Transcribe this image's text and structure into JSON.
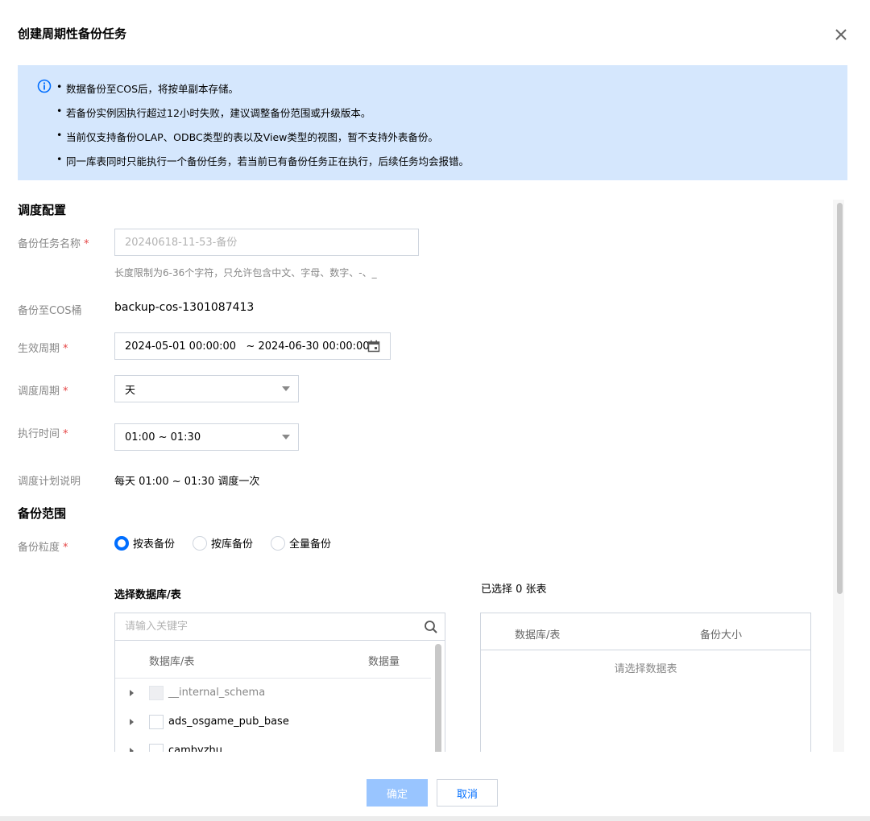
{
  "dialog": {
    "title": "创建周期性备份任务"
  },
  "notice": {
    "items": [
      "数据备份至COS后，将按单副本存储。",
      "若备份实例因执行超过12小时失败，建议调整备份范围或升级版本。",
      "当前仅支持备份OLAP、ODBC类型的表以及View类型的视图，暂不支持外表备份。",
      "同一库表同时只能执行一个备份任务，若当前已有备份任务正在执行，后续任务均会报错。"
    ]
  },
  "schedule": {
    "section_title": "调度配置",
    "task_name": {
      "label": "备份任务名称",
      "placeholder": "20240618-11-53-备份",
      "value": "",
      "hint": "长度限制为6-36个字符，只允许包含中文、字母、数字、-、_"
    },
    "cos_bucket": {
      "label": "备份至COS桶",
      "value": "backup-cos-1301087413"
    },
    "effective_period": {
      "label": "生效周期",
      "value": "2024-05-01 00:00:00   ~ 2024-06-30 00:00:00"
    },
    "schedule_cycle": {
      "label": "调度周期",
      "value": "天"
    },
    "exec_time": {
      "label": "执行时间",
      "value": "01:00 ~ 01:30"
    },
    "plan_desc": {
      "label": "调度计划说明",
      "value": "每天 01:00 ~ 01:30 调度一次"
    }
  },
  "scope": {
    "section_title": "备份范围",
    "granularity": {
      "label": "备份粒度",
      "options": [
        "按表备份",
        "按库备份",
        "全量备份"
      ],
      "selected": "按表备份"
    },
    "select_title": "选择数据库/表",
    "search_placeholder": "请输入关键字",
    "tree_columns": [
      "数据库/表",
      "数据量"
    ],
    "tree_rows": [
      {
        "name": "__internal_schema",
        "disabled": true
      },
      {
        "name": "ads_osgame_pub_base",
        "disabled": false
      },
      {
        "name": "cambyzhu",
        "disabled": false
      }
    ],
    "selected_title": "已选择 0 张表",
    "selected_columns": [
      "数据库/表",
      "备份大小"
    ],
    "empty_text": "请选择数据表"
  },
  "footer": {
    "confirm": "确定",
    "cancel": "取消"
  },
  "colors": {
    "accent": "#006eff",
    "notice_bg": "#d5e7fd",
    "required": "#e54545",
    "confirm_disabled": "#99c5ff"
  }
}
